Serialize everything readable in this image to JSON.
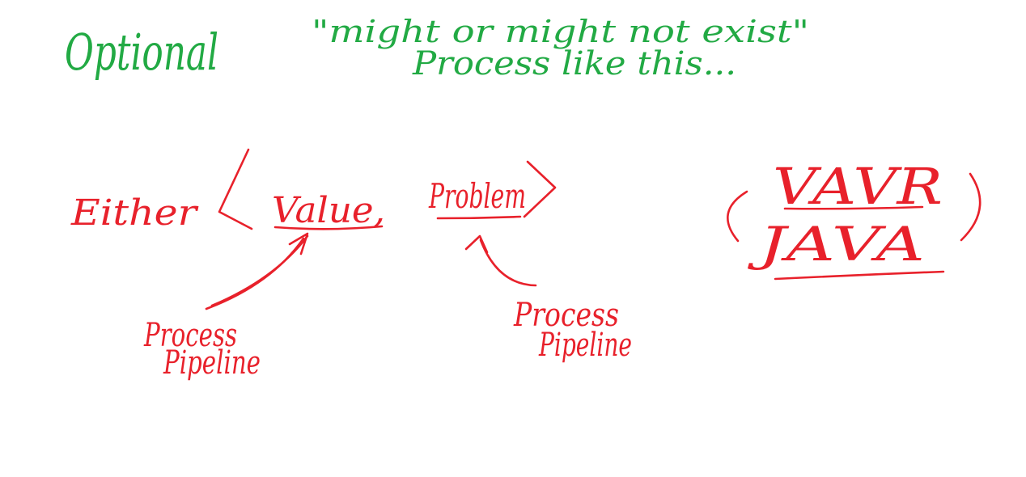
{
  "colors": {
    "green_ink": "#22aa44",
    "red_ink": "#e8212b",
    "background": "#ffffff"
  },
  "notes": {
    "optional_word": "Optional",
    "quote_line1": "\"might or might not exist\"",
    "quote_line2": "Process like this...",
    "either_word": "Either",
    "value_word": "Value,",
    "problem_word": "Problem",
    "left_caption_line1": "Process",
    "left_caption_line2": "Pipeline",
    "right_caption_line1": "Process",
    "right_caption_line2": "Pipeline",
    "vavr_word": "VAVR",
    "java_word": "JAVA"
  }
}
